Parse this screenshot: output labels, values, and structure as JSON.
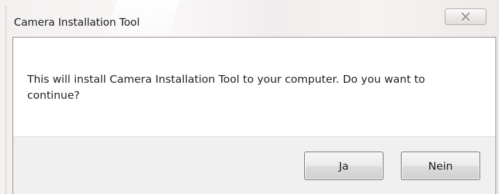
{
  "window": {
    "title": "Camera Installation Tool",
    "close_icon": "close-icon"
  },
  "dialog": {
    "message": "This will install Camera Installation Tool to your computer. Do you want to continue?",
    "buttons": {
      "yes": "Ja",
      "no": "Nein"
    }
  }
}
